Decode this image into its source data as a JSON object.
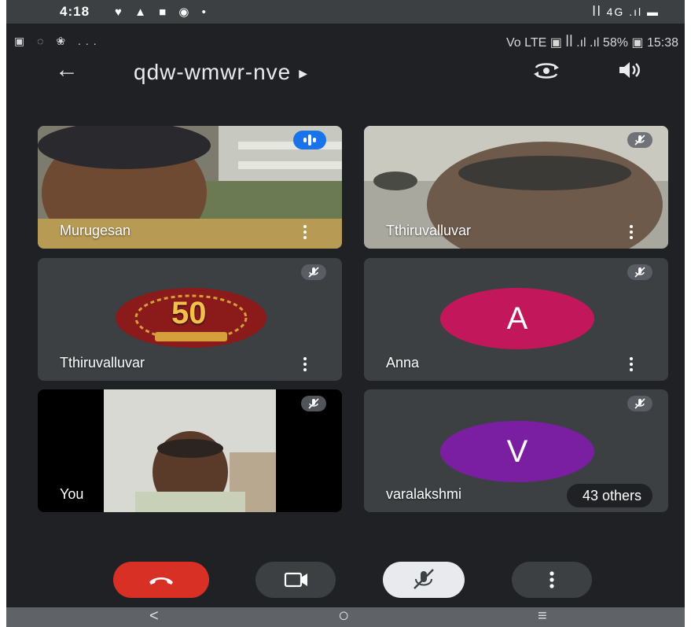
{
  "status_outer": {
    "time": "4:18",
    "icons_left": "♥ ▲ ■ ◉ •",
    "network": "ꟾꟾ 4G .ıl ▬"
  },
  "status_inner": {
    "icons_left": "▣ ◌ ❀ ...",
    "icons_right": "Vo LTE ▣ ꟾꟾ .ıl .ıl 58% ▣ 15:38"
  },
  "header": {
    "meeting_code": "qdw-wmwr-nve",
    "back_icon": "←",
    "switch_camera_icon": "switch-camera",
    "speaker_icon": "speaker"
  },
  "participants": [
    {
      "name": "Murugesan",
      "state": "speaking"
    },
    {
      "name": "Tthiruvalluvar",
      "state": "muted"
    },
    {
      "name": "Tthiruvalluvar",
      "state": "muted",
      "logo_text": "50"
    },
    {
      "name": "Anna",
      "state": "muted",
      "initial": "A",
      "color": "#c2185b"
    },
    {
      "name": "You",
      "state": "muted"
    },
    {
      "name": "varalakshmi",
      "state": "muted",
      "initial": "V",
      "color": "#7b1fa2"
    }
  ],
  "others_badge": "43 others",
  "controls": {
    "end_call_color": "#d93025",
    "camera_icon": "camera",
    "mic_icon": "mic-off",
    "more_icon": "more-vertical"
  },
  "navbar": {
    "back": "<",
    "home": "○",
    "recents": "≡"
  }
}
